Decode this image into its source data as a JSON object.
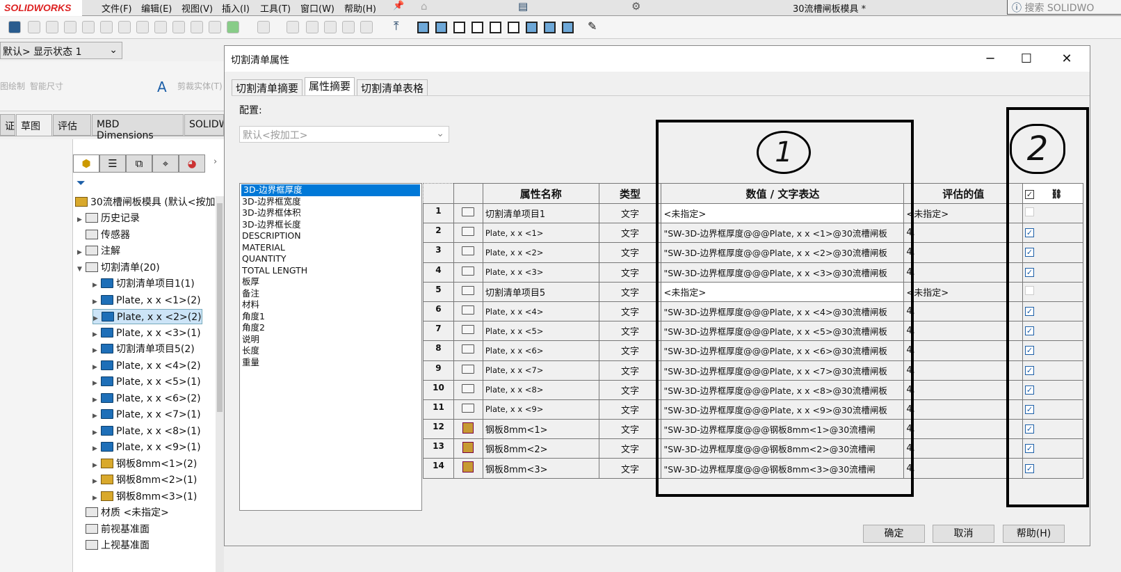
{
  "app": {
    "logo": "SOLIDWORKS",
    "menu": [
      "文件(F)",
      "编辑(E)",
      "视图(V)",
      "插入(I)",
      "工具(T)",
      "窗口(W)",
      "帮助(H)"
    ],
    "doc_title": "30流槽闸板模具 *",
    "search_placeholder": "搜索 SOLIDWO"
  },
  "config_selector": "默认> 显示状态 1",
  "command_manager": {
    "items": [
      "图绘制",
      "智能尺寸",
      "剪裁实体(T)"
    ],
    "tabs": [
      "证",
      "草图",
      "评估",
      "MBD Dimensions",
      "SOLIDW"
    ]
  },
  "tree": {
    "root": "30流槽闸板模具 (默认<按加",
    "items": [
      {
        "label": "历史记录",
        "icon": "history-folder",
        "arrow": "▶",
        "indent": 0
      },
      {
        "label": "传感器",
        "icon": "sensor-folder",
        "arrow": "",
        "indent": 0
      },
      {
        "label": "注解",
        "icon": "annotation-folder",
        "arrow": "▶",
        "indent": 0
      },
      {
        "label": "切割清单(20)",
        "icon": "cut-list",
        "arrow": "▼",
        "indent": 0
      },
      {
        "label": "切割清单项目1(1)",
        "icon": "folder",
        "arrow": "▶",
        "indent": 1
      },
      {
        "label": "Plate, x x <1>(2)",
        "icon": "folder",
        "arrow": "▶",
        "indent": 1
      },
      {
        "label": "Plate, x x <2>(2)",
        "icon": "folder",
        "arrow": "▶",
        "indent": 1,
        "selected": true
      },
      {
        "label": "Plate, x x <3>(1)",
        "icon": "folder",
        "arrow": "▶",
        "indent": 1
      },
      {
        "label": "切割清单项目5(2)",
        "icon": "folder",
        "arrow": "▶",
        "indent": 1
      },
      {
        "label": "Plate, x x <4>(2)",
        "icon": "folder",
        "arrow": "▶",
        "indent": 1
      },
      {
        "label": "Plate, x x <5>(1)",
        "icon": "folder",
        "arrow": "▶",
        "indent": 1
      },
      {
        "label": "Plate, x x <6>(2)",
        "icon": "folder",
        "arrow": "▶",
        "indent": 1
      },
      {
        "label": "Plate, x x <7>(1)",
        "icon": "folder",
        "arrow": "▶",
        "indent": 1
      },
      {
        "label": "Plate, x x <8>(1)",
        "icon": "folder",
        "arrow": "▶",
        "indent": 1
      },
      {
        "label": "Plate, x x <9>(1)",
        "icon": "folder",
        "arrow": "▶",
        "indent": 1
      },
      {
        "label": "钢板8mm<1>(2)",
        "icon": "sheet-metal",
        "arrow": "▶",
        "indent": 1
      },
      {
        "label": "钢板8mm<2>(1)",
        "icon": "sheet-metal",
        "arrow": "▶",
        "indent": 1
      },
      {
        "label": "钢板8mm<3>(1)",
        "icon": "sheet-metal",
        "arrow": "▶",
        "indent": 1
      },
      {
        "label": "材质 <未指定>",
        "icon": "material",
        "arrow": "",
        "indent": 0
      },
      {
        "label": "前视基准面",
        "icon": "plane",
        "arrow": "",
        "indent": 0
      },
      {
        "label": "上视基准面",
        "icon": "plane",
        "arrow": "",
        "indent": 0
      }
    ]
  },
  "dialog": {
    "title": "切割清单属性",
    "tabs": [
      "切割清单摘要",
      "属性摘要",
      "切割清单表格"
    ],
    "active_tab": 1,
    "config_label": "配置:",
    "config_value": "默认<按加工>",
    "properties": [
      "3D-边界框厚度",
      "3D-边界框宽度",
      "3D-边界框体积",
      "3D-边界框长度",
      "DESCRIPTION",
      "MATERIAL",
      "QUANTITY",
      "TOTAL LENGTH",
      "板厚",
      "备注",
      "材料",
      "角度1",
      "角度2",
      "说明",
      "长度",
      "重量"
    ],
    "columns": [
      "属性名称",
      "类型",
      "数值 / 文字表达",
      "评估的值"
    ],
    "rows": [
      {
        "num": "1",
        "icon": "folder",
        "name": "切割清单项目1",
        "type": "文字",
        "value": "<未指定>",
        "eval": "<未指定>",
        "checked": false
      },
      {
        "num": "2",
        "icon": "folder",
        "name": "Plate, x x <1>",
        "type": "文字",
        "value": "\"SW-3D-边界框厚度@@@Plate, x x <1>@30流槽闸板",
        "eval": "4.",
        "checked": true
      },
      {
        "num": "3",
        "icon": "folder",
        "name": "Plate, x x <2>",
        "type": "文字",
        "value": "\"SW-3D-边界框厚度@@@Plate, x x <2>@30流槽闸板",
        "eval": "4.",
        "checked": true
      },
      {
        "num": "4",
        "icon": "folder",
        "name": "Plate, x x <3>",
        "type": "文字",
        "value": "\"SW-3D-边界框厚度@@@Plate, x x <3>@30流槽闸板",
        "eval": "4.",
        "checked": true
      },
      {
        "num": "5",
        "icon": "folder",
        "name": "切割清单项目5",
        "type": "文字",
        "value": "<未指定>",
        "eval": "<未指定>",
        "checked": false
      },
      {
        "num": "6",
        "icon": "folder",
        "name": "Plate, x x <4>",
        "type": "文字",
        "value": "\"SW-3D-边界框厚度@@@Plate, x x <4>@30流槽闸板",
        "eval": "4.",
        "checked": true
      },
      {
        "num": "7",
        "icon": "folder",
        "name": "Plate, x x <5>",
        "type": "文字",
        "value": "\"SW-3D-边界框厚度@@@Plate, x x <5>@30流槽闸板",
        "eval": "4.",
        "checked": true
      },
      {
        "num": "8",
        "icon": "folder",
        "name": "Plate, x x <6>",
        "type": "文字",
        "value": "\"SW-3D-边界框厚度@@@Plate, x x <6>@30流槽闸板",
        "eval": "4.",
        "checked": true
      },
      {
        "num": "9",
        "icon": "folder",
        "name": "Plate, x x <7>",
        "type": "文字",
        "value": "\"SW-3D-边界框厚度@@@Plate, x x <7>@30流槽闸板",
        "eval": "4.",
        "checked": true
      },
      {
        "num": "10",
        "icon": "folder",
        "name": "Plate, x x <8>",
        "type": "文字",
        "value": "\"SW-3D-边界框厚度@@@Plate, x x <8>@30流槽闸板",
        "eval": "4.",
        "checked": true
      },
      {
        "num": "11",
        "icon": "folder",
        "name": "Plate, x x <9>",
        "type": "文字",
        "value": "\"SW-3D-边界框厚度@@@Plate, x x <9>@30流槽闸板",
        "eval": "4.",
        "checked": true
      },
      {
        "num": "12",
        "icon": "sheet-metal",
        "name": "钢板8mm<1>",
        "type": "文字",
        "value": "\"SW-3D-边界框厚度@@@钢板8mm<1>@30流槽闸",
        "eval": "4.",
        "checked": true
      },
      {
        "num": "13",
        "icon": "sheet-metal",
        "name": "钢板8mm<2>",
        "type": "文字",
        "value": "\"SW-3D-边界框厚度@@@钢板8mm<2>@30流槽闸",
        "eval": "4.",
        "checked": true
      },
      {
        "num": "14",
        "icon": "sheet-metal",
        "name": "钢板8mm<3>",
        "type": "文字",
        "value": "\"SW-3D-边界框厚度@@@钢板8mm<3>@30流槽闸",
        "eval": "4.",
        "checked": true
      }
    ],
    "buttons": {
      "ok": "确定",
      "cancel": "取消",
      "help": "帮助(H)"
    }
  },
  "annotations": [
    "1",
    "2"
  ],
  "colors": {
    "selection": "#0078d7",
    "brand": "#d22222",
    "checkbox": "#1c5fa8"
  }
}
